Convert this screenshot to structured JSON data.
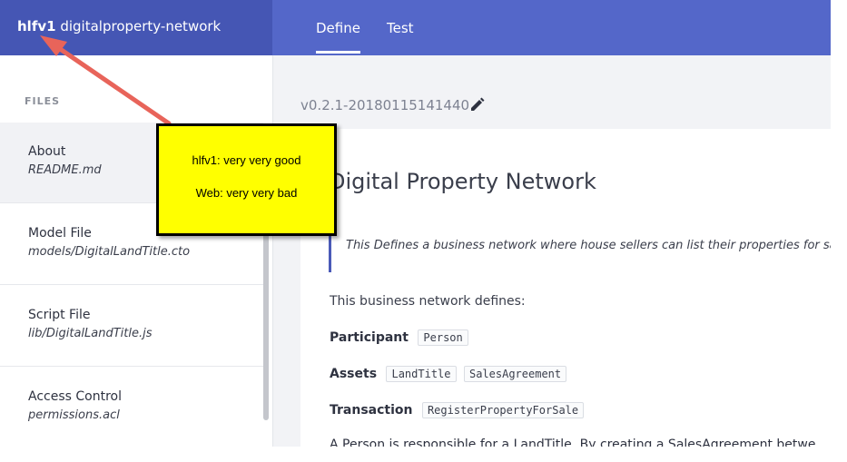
{
  "header": {
    "brand_bold": "hlfv1",
    "brand_rest": "digitalproperty-network",
    "tabs": [
      {
        "label": "Define",
        "active": true
      },
      {
        "label": "Test",
        "active": false
      }
    ],
    "colors": {
      "left": "#4556b4",
      "right": "#5467c9"
    }
  },
  "sidebar": {
    "section_title": "FILES",
    "items": [
      {
        "title": "About",
        "subtitle": "README.md"
      },
      {
        "title": "Model File",
        "subtitle": "models/DigitalLandTitle.cto"
      },
      {
        "title": "Script File",
        "subtitle": "lib/DigitalLandTitle.js"
      },
      {
        "title": "Access Control",
        "subtitle": "permissions.acl"
      }
    ]
  },
  "main": {
    "version": "v0.2.1-20180115141440",
    "edit_icon": "pencil-icon",
    "doc": {
      "title": "Digital Property Network",
      "quote": "This Defines a business network where house sellers can list their properties for sale.",
      "intro": "This business network defines:",
      "participant_label": "Participant",
      "participants": [
        "Person"
      ],
      "assets_label": "Assets",
      "assets": [
        "LandTitle",
        "SalesAgreement"
      ],
      "transaction_label": "Transaction",
      "transactions": [
        "RegisterPropertyForSale"
      ],
      "cut_line": "A Person is responsible for a LandTitle. By creating a SalesAgreement betwe"
    }
  },
  "annotation": {
    "line1": "hlfv1:  very very good",
    "line2": "Web:  very very bad",
    "background": "#ffff00",
    "arrow_color": "#e8645a"
  }
}
